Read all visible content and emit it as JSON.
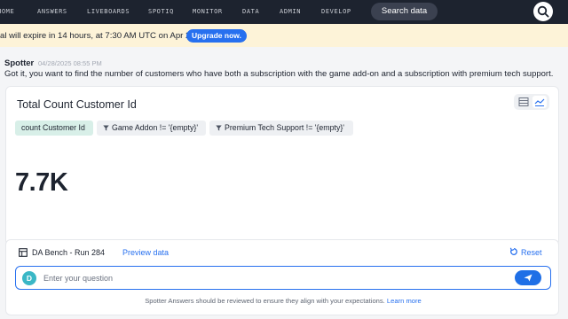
{
  "topnav": {
    "items": [
      "HOME",
      "ANSWERS",
      "LIVEBOARDS",
      "SPOTIQ",
      "MONITOR",
      "DATA",
      "ADMIN",
      "DEVELOP"
    ],
    "search_label": "Search data",
    "search_icon": "search-icon"
  },
  "banner": {
    "text": "al will expire in 14 hours, at 7:30 AM UTC on Apr 29.",
    "button_label": "Upgrade now."
  },
  "message": {
    "author": "Spotter",
    "timestamp": "04/28/2025 08:55 PM",
    "text": "Got it, you want to find the number of customers who have both a subscription with the game add-on and a subscription with premium tech support."
  },
  "answer": {
    "title": "Total Count Customer Id",
    "chips": [
      {
        "label": "count Customer Id",
        "type": "measure"
      },
      {
        "label": "Game Addon != '{empty}'",
        "type": "filter"
      },
      {
        "label": "Premium Tech Support != '{empty}'",
        "type": "filter"
      }
    ],
    "kpi_value": "7.7K",
    "viz_icons": [
      "table-icon",
      "chart-icon"
    ]
  },
  "composer": {
    "datasource": "DA Bench - Run 284",
    "preview_label": "Preview data",
    "reset_label": "Reset",
    "placeholder": "Enter your question",
    "avatar_initial": "D",
    "disclaimer": "Spotter Answers should be reviewed to ensure they align with your expectations.",
    "learn_more": "Learn more"
  },
  "colors": {
    "nav_bg": "#1d232f",
    "accent": "#2770ef",
    "banner_bg": "#fdf3d8",
    "measure_chip": "#d8efe8"
  }
}
